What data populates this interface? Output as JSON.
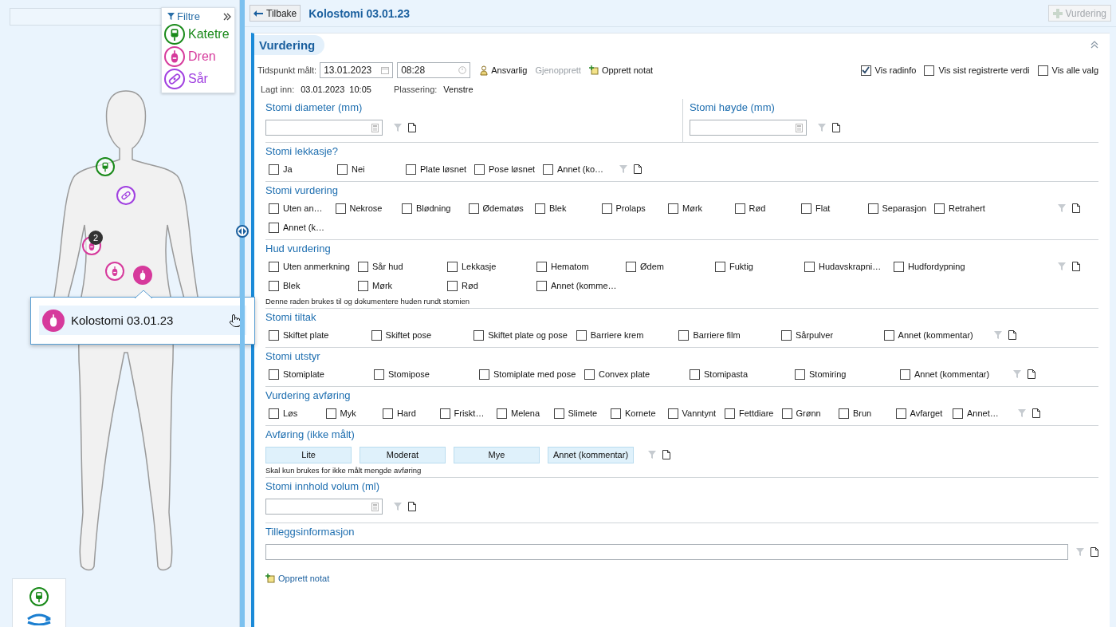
{
  "left_panel": {
    "filter": {
      "title": "Filtre",
      "items": [
        {
          "kind": "katetre",
          "label": "Katetre",
          "color": "#1a8a1a"
        },
        {
          "kind": "dren",
          "label": "Dren",
          "color": "#d63a9c"
        },
        {
          "kind": "sar",
          "label": "Sår",
          "color": "#a040e0"
        }
      ]
    },
    "markers": [
      {
        "kind": "katetre",
        "selected": false
      },
      {
        "kind": "sar",
        "selected": false
      },
      {
        "kind": "dren",
        "selected": false,
        "badge": "2"
      },
      {
        "kind": "dren",
        "selected": false
      },
      {
        "kind": "dren",
        "selected": true
      }
    ],
    "popup": {
      "kind": "dren",
      "label": "Kolostomi 03.01.23"
    }
  },
  "header": {
    "back": "Tilbake",
    "title": "Kolostomi 03.01.23",
    "add_button": {
      "label": "Vurdering",
      "disabled": true
    }
  },
  "form": {
    "title": "Vurdering",
    "time_label": "Tidspunkt målt:",
    "date": "13.01.2023",
    "time": "08:28",
    "actions": [
      {
        "kind": "person",
        "label": "Ansvarlig",
        "disabled": false
      },
      {
        "kind": "plain",
        "label": "Gjenopprett",
        "disabled": true
      },
      {
        "kind": "note",
        "label": "Opprett notat",
        "disabled": false
      }
    ],
    "toggles": [
      {
        "label": "Vis radinfo",
        "checked": true
      },
      {
        "label": "Vis sist registrerte verdi",
        "checked": false
      },
      {
        "label": "Vis alle valg",
        "checked": false
      }
    ],
    "info": [
      {
        "label": "Lagt inn:",
        "value": "03.01.2023  10:05"
      },
      {
        "label": "Plassering:",
        "value": "Venstre"
      }
    ],
    "sections": [
      {
        "kind": "measure_pair",
        "fields": [
          {
            "title": "Stomi diameter (mm)"
          },
          {
            "title": "Stomi høyde (mm)"
          }
        ]
      },
      {
        "kind": "choices",
        "title": "Stomi lekkasje?",
        "options": [
          {
            "label": "Ja",
            "checked": false
          },
          {
            "label": "Nei",
            "checked": false
          },
          {
            "label": "Plate løsnet",
            "checked": false
          },
          {
            "label": "Pose løsnet",
            "checked": false
          },
          {
            "label": "Annet (ko…",
            "checked": false
          }
        ]
      },
      {
        "kind": "choices",
        "title": "Stomi vurdering",
        "options": [
          {
            "label": "Uten an…",
            "checked": false
          },
          {
            "label": "Nekrose",
            "checked": false
          },
          {
            "label": "Blødning",
            "checked": false
          },
          {
            "label": "Ødematøs",
            "checked": false
          },
          {
            "label": "Blek",
            "checked": false
          },
          {
            "label": "Prolaps",
            "checked": false
          },
          {
            "label": "Mørk",
            "checked": false
          },
          {
            "label": "Rød",
            "checked": false
          },
          {
            "label": "Flat",
            "checked": false
          },
          {
            "label": "Separasjon",
            "checked": false
          },
          {
            "label": "Retrahert",
            "checked": false
          },
          {
            "label": "Annet (k…",
            "checked": false
          }
        ]
      },
      {
        "kind": "choices",
        "title": "Hud vurdering",
        "note": "Denne raden brukes til og dokumentere huden rundt stomien",
        "options": [
          {
            "label": "Uten anmerkning",
            "checked": false
          },
          {
            "label": "Sår hud",
            "checked": false
          },
          {
            "label": "Lekkasje",
            "checked": false
          },
          {
            "label": "Hematom",
            "checked": false
          },
          {
            "label": "Ødem",
            "checked": false
          },
          {
            "label": "Fuktig",
            "checked": false
          },
          {
            "label": "Hudavskrapni…",
            "checked": false
          },
          {
            "label": "Hudfordypning",
            "checked": false
          },
          {
            "label": "Blek",
            "checked": false
          },
          {
            "label": "Mørk",
            "checked": false
          },
          {
            "label": "Rød",
            "checked": false
          },
          {
            "label": "Annet (komme…",
            "checked": false
          }
        ]
      },
      {
        "kind": "choices",
        "title": "Stomi tiltak",
        "options": [
          {
            "label": "Skiftet plate",
            "checked": false
          },
          {
            "label": "Skiftet pose",
            "checked": false
          },
          {
            "label": "Skiftet plate og pose",
            "checked": false
          },
          {
            "label": "Barriere krem",
            "checked": false
          },
          {
            "label": "Barriere film",
            "checked": false
          },
          {
            "label": "Sårpulver",
            "checked": false
          },
          {
            "label": "Annet (kommentar)",
            "checked": false
          }
        ]
      },
      {
        "kind": "choices",
        "title": "Stomi utstyr",
        "options": [
          {
            "label": "Stomiplate",
            "checked": false
          },
          {
            "label": "Stomipose",
            "checked": false
          },
          {
            "label": "Stomiplate med pose",
            "checked": false
          },
          {
            "label": "Convex plate",
            "checked": false
          },
          {
            "label": "Stomipasta",
            "checked": false
          },
          {
            "label": "Stomiring",
            "checked": false
          },
          {
            "label": "Annet (kommentar)",
            "checked": false
          }
        ]
      },
      {
        "kind": "choices",
        "title": "Vurdering avføring",
        "options": [
          {
            "label": "Løs",
            "checked": false
          },
          {
            "label": "Myk",
            "checked": false
          },
          {
            "label": "Hard",
            "checked": false
          },
          {
            "label": "Friskt…",
            "checked": false
          },
          {
            "label": "Melena",
            "checked": false
          },
          {
            "label": "Slimete",
            "checked": false
          },
          {
            "label": "Kornete",
            "checked": false
          },
          {
            "label": "Vanntynt",
            "checked": false
          },
          {
            "label": "Fettdiare",
            "checked": false
          },
          {
            "label": "Grønn",
            "checked": false
          },
          {
            "label": "Brun",
            "checked": false
          },
          {
            "label": "Avfarget",
            "checked": false
          },
          {
            "label": "Annet…",
            "checked": false
          }
        ]
      },
      {
        "kind": "segments",
        "title": "Avføring (ikke målt)",
        "note": "Skal kun brukes for ikke målt mengde avføring",
        "options": [
          {
            "label": "Lite",
            "selected": false
          },
          {
            "label": "Moderat",
            "selected": false
          },
          {
            "label": "Mye",
            "selected": false
          },
          {
            "label": "Annet (kommentar)",
            "selected": false
          }
        ]
      },
      {
        "kind": "measure",
        "title": "Stomi innhold volum (ml)"
      },
      {
        "kind": "text",
        "title": "Tilleggsinformasjon"
      }
    ],
    "footer_action": "Opprett notat"
  }
}
